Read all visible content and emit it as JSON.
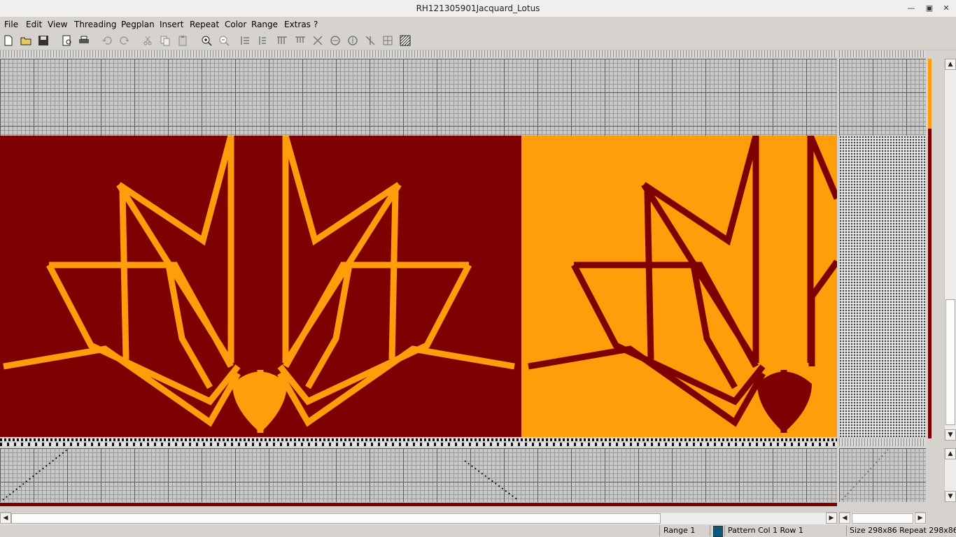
{
  "window": {
    "title": "RH121305901Jacquard_Lotus"
  },
  "menu": [
    "File",
    "Edit",
    "View",
    "Threading",
    "Pegplan",
    "Insert",
    "Repeat",
    "Color",
    "Range",
    "Extras",
    "?"
  ],
  "toolbar": {
    "icons": [
      "new-icon",
      "open-icon",
      "save-icon",
      "print-preview-icon",
      "print-icon",
      "undo-icon",
      "redo-icon",
      "cut-icon",
      "copy-icon",
      "paste-icon",
      "zoom-in-icon",
      "zoom-out-icon",
      "tool-1-icon",
      "tool-2-icon",
      "tool-3-icon",
      "tool-4-icon",
      "tool-5-icon",
      "tool-6-icon",
      "tool-7-icon",
      "tool-8-icon",
      "tool-9-icon"
    ]
  },
  "colors": {
    "warp": "#7e0000",
    "weft": "#ff9d0a",
    "selected_swatch": "#0b5a7a"
  },
  "status": {
    "range": "Range 1",
    "pattern": "Pattern  Col 1  Row 1",
    "size": "Size 298x86  Repeat 298x86"
  }
}
